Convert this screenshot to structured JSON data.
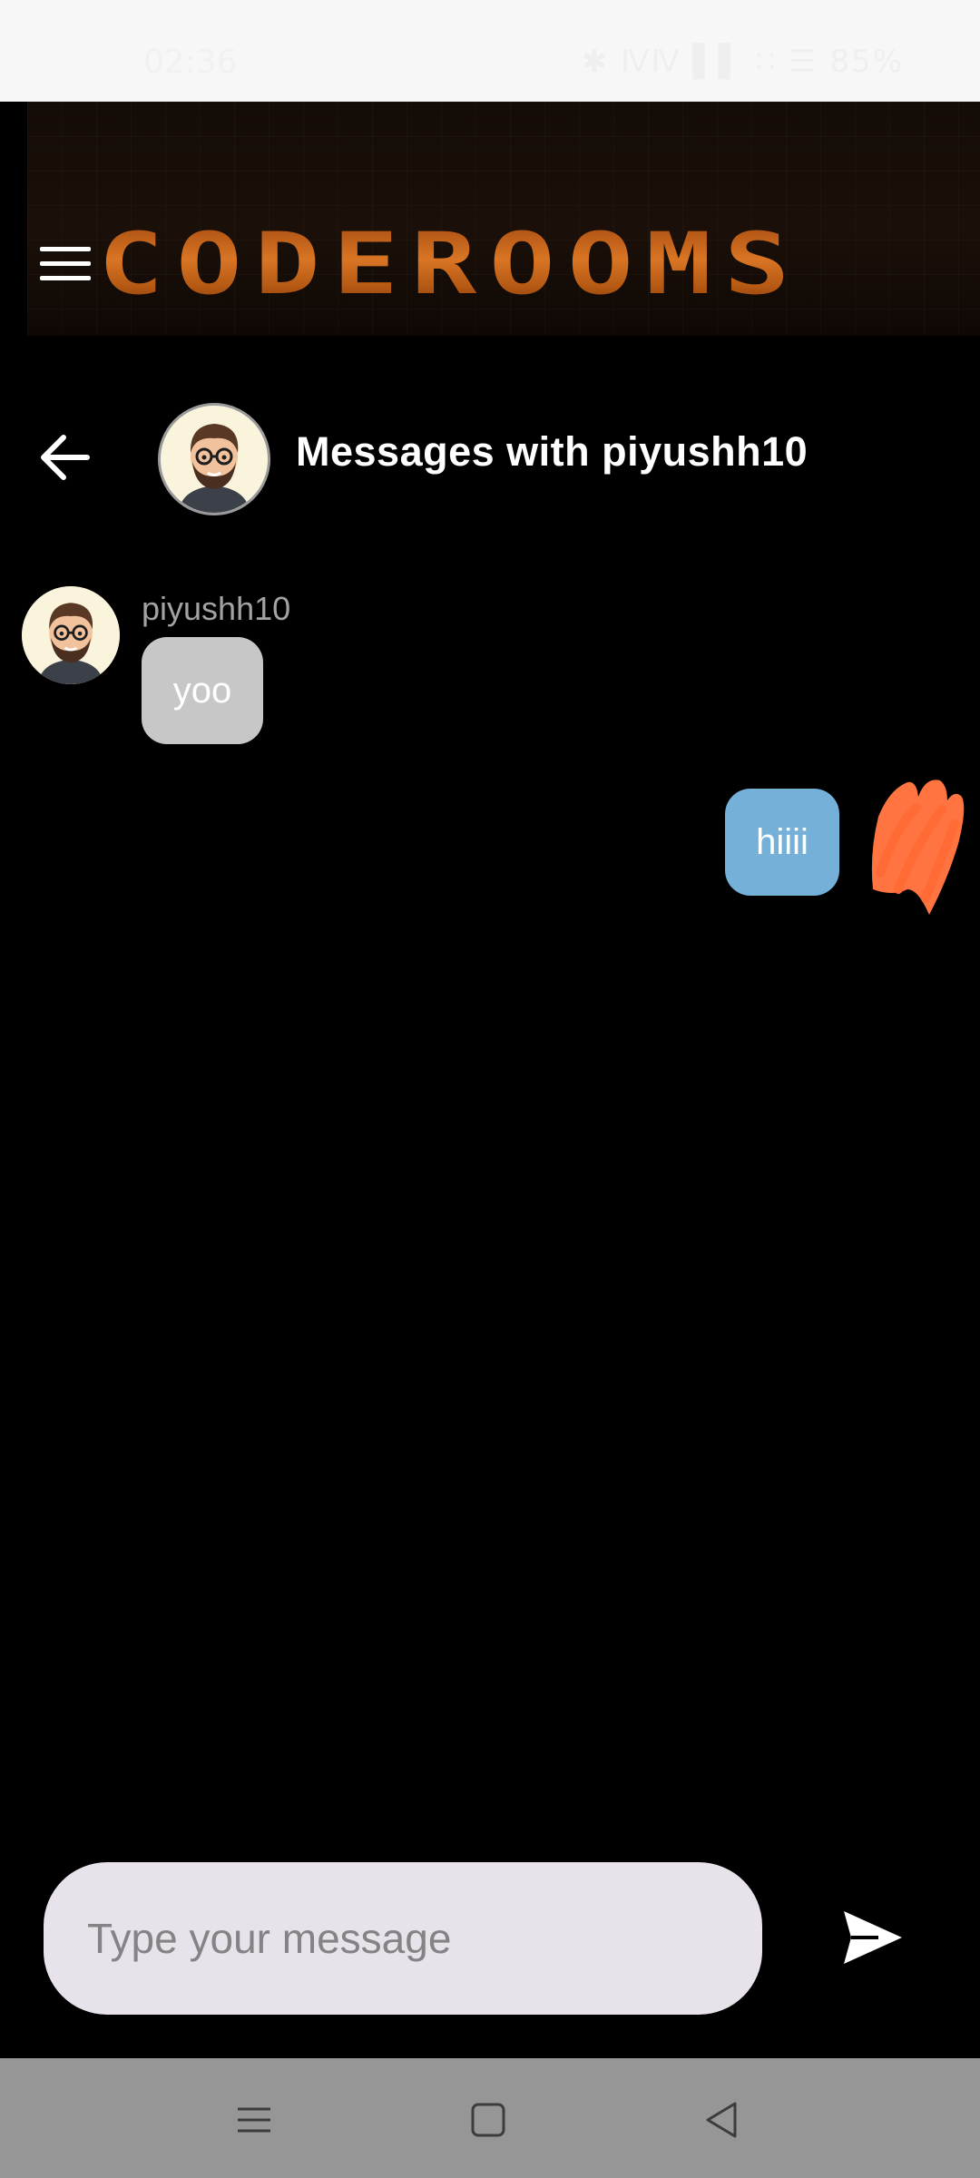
{
  "status_bar": {
    "time": "02:36",
    "indicators": "✱ ⅣⅣ ▌▌  ∷  ☰ 85%",
    "battery": "85%"
  },
  "banner": {
    "logo_text": "CODEROOMS",
    "menu_icon": "hamburger-menu-icon"
  },
  "chat_header": {
    "back_icon": "arrow-left-icon",
    "title": "Messages with piyushh10"
  },
  "messages": [
    {
      "direction": "incoming",
      "username": "piyushh10",
      "text": "yoo"
    },
    {
      "direction": "outgoing",
      "text": "hiiii"
    }
  ],
  "composer": {
    "placeholder": "Type your message",
    "value": "",
    "send_icon": "send-icon"
  },
  "nav_bar": {
    "items": [
      "recent-apps-icon",
      "home-icon",
      "back-triangle-icon"
    ]
  },
  "colors": {
    "background": "#000000",
    "incoming_bubble": "#c7c7c7",
    "outgoing_bubble": "#75b0d9",
    "input_background": "#e8e3ea",
    "logo_orange": "#d97524",
    "nav_bar": "#969696"
  }
}
